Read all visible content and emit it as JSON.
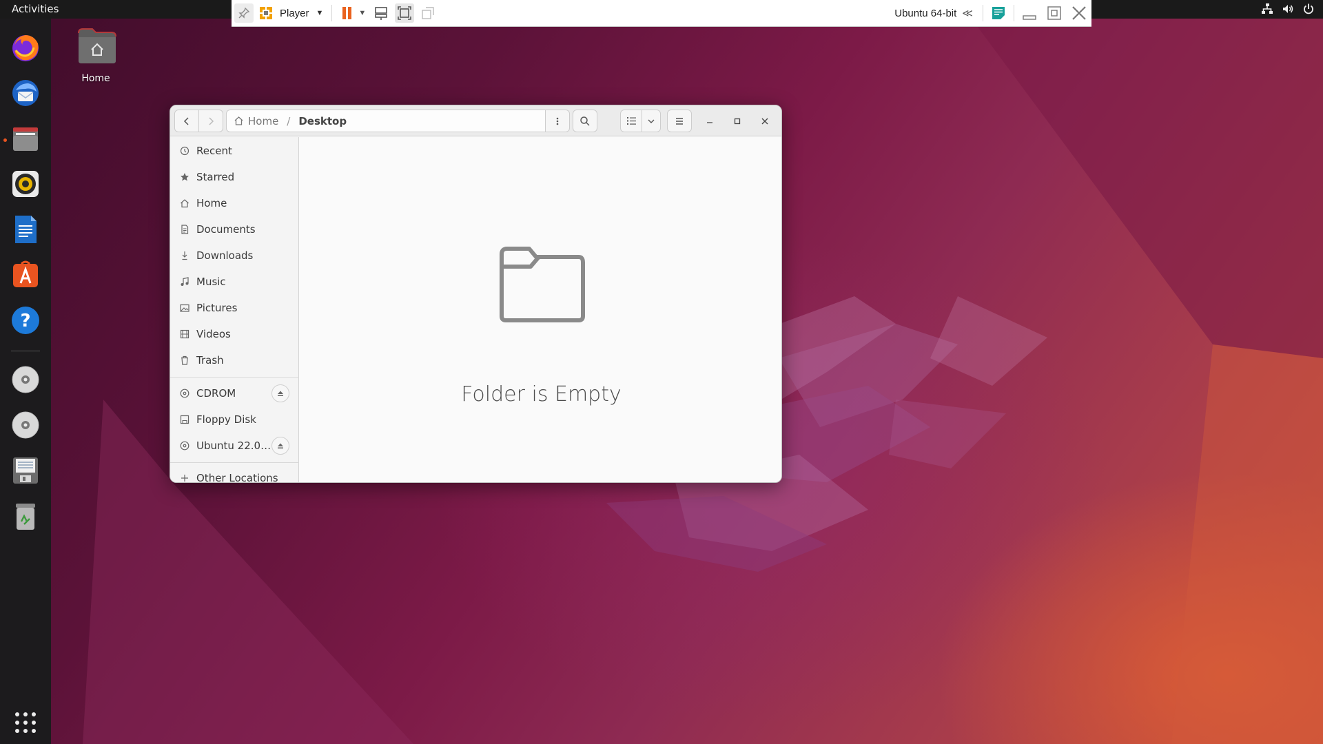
{
  "topbar": {
    "activities": "Activities",
    "tray_icons": [
      "network-icon",
      "volume-icon",
      "power-icon"
    ]
  },
  "vmware": {
    "player_label": "Player",
    "vm_name": "Ubuntu 64-bit",
    "colors": {
      "pause": "#e9621e",
      "player_icon": "#f2a100",
      "notes": "#18a19a"
    }
  },
  "dock": {
    "apps": [
      "firefox-icon",
      "thunderbird-icon",
      "files-icon",
      "rhythmbox-icon",
      "libreoffice-writer-icon",
      "app-center-icon",
      "help-icon"
    ],
    "devices": [
      "cdrom-icon",
      "ubuntu-disc-icon",
      "floppy-icon",
      "trash-icon"
    ],
    "running_app": "files-icon"
  },
  "desktop": {
    "home_label": "Home"
  },
  "files": {
    "path": {
      "home": "Home",
      "separator": "/",
      "current": "Desktop"
    },
    "sidebar": {
      "places": [
        {
          "label": "Recent",
          "icon": "clock-icon"
        },
        {
          "label": "Starred",
          "icon": "star-icon"
        },
        {
          "label": "Home",
          "icon": "home-icon"
        },
        {
          "label": "Documents",
          "icon": "document-icon"
        },
        {
          "label": "Downloads",
          "icon": "download-icon"
        },
        {
          "label": "Music",
          "icon": "music-icon"
        },
        {
          "label": "Pictures",
          "icon": "picture-icon"
        },
        {
          "label": "Videos",
          "icon": "video-icon"
        },
        {
          "label": "Trash",
          "icon": "trash-icon"
        }
      ],
      "devices": [
        {
          "label": "CDROM",
          "icon": "disc-icon",
          "ejectable": true
        },
        {
          "label": "Floppy Disk",
          "icon": "floppy-icon",
          "ejectable": false
        },
        {
          "label": "Ubuntu 22.0…",
          "icon": "disc-icon",
          "ejectable": true
        }
      ],
      "other": "Other Locations"
    },
    "empty_message": "Folder is Empty"
  }
}
